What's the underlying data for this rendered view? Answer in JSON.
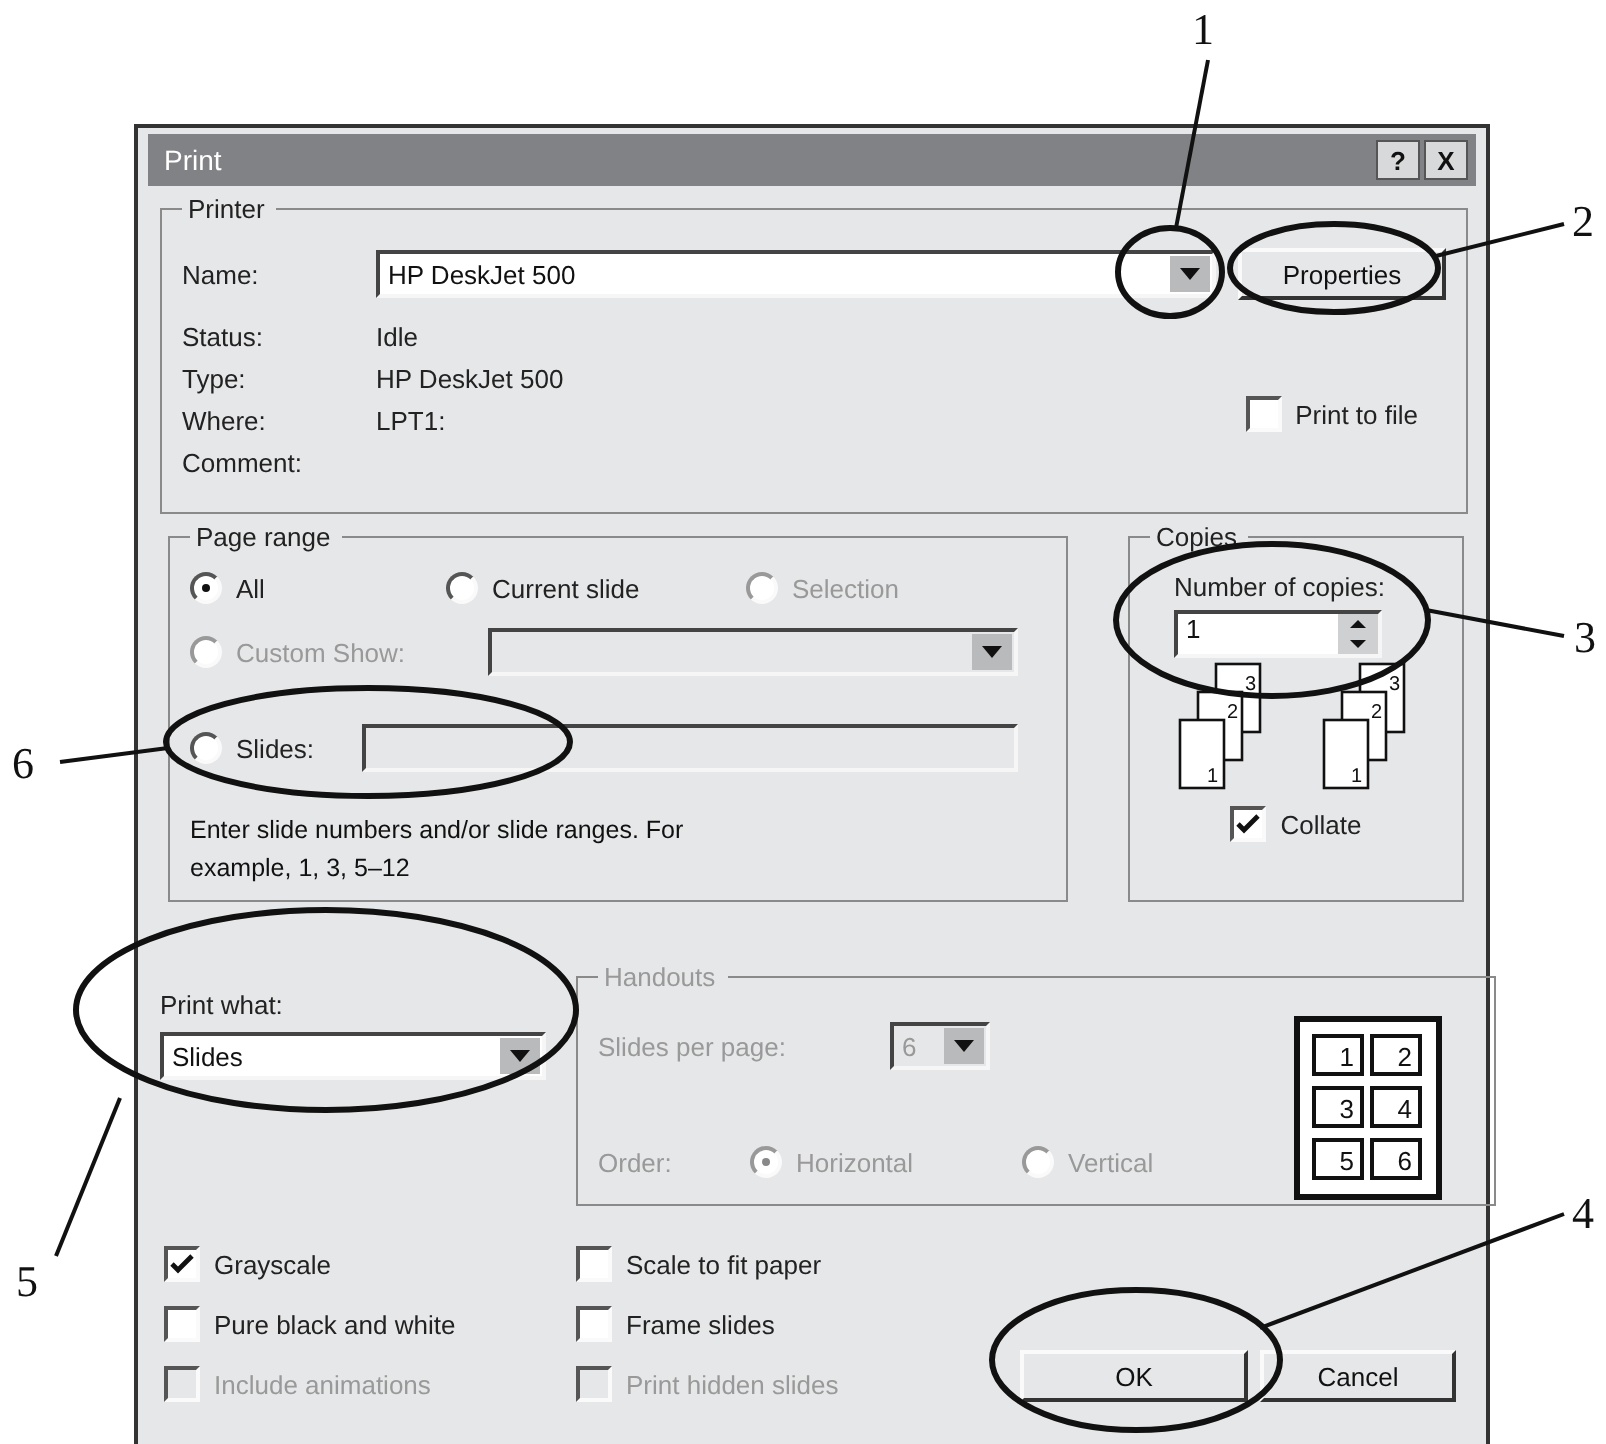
{
  "window": {
    "title": "Print",
    "title_buttons": [
      "?",
      "X"
    ]
  },
  "printer": {
    "legend": "Printer",
    "name_label": "Name:",
    "name_value": "HP DeskJet 500",
    "properties_button": "Properties",
    "details": [
      {
        "label": "Status:",
        "value": "Idle"
      },
      {
        "label": "Type:",
        "value": "HP DeskJet 500"
      },
      {
        "label": "Where:",
        "value": "LPT1:"
      },
      {
        "label": "Comment:"
      }
    ],
    "print_to_file": {
      "label": "Print to file",
      "checked": false
    }
  },
  "page_range": {
    "legend": "Page range",
    "options": [
      {
        "label": "All",
        "selected": true,
        "disabled": false
      },
      {
        "label": "Current slide",
        "selected": false,
        "disabled": false
      },
      {
        "label": "Selection",
        "selected": false,
        "disabled": true
      }
    ],
    "custom_show": {
      "label": "Custom Show:",
      "selected": false,
      "disabled": true
    },
    "slides": {
      "label": "Slides:",
      "selected": false,
      "disabled": false
    },
    "hint": "Enter slide numbers and/or slide ranges. For example, 1, 3, 5–12"
  },
  "copies": {
    "legend": "Copies",
    "label": "Number of copies:",
    "value": "1",
    "stacks": [
      {
        "pages": [
          "1",
          "2",
          "3"
        ]
      },
      {
        "pages": [
          "1",
          "2",
          "3"
        ]
      }
    ],
    "collate": {
      "label": "Collate",
      "checked": true
    }
  },
  "print_what": {
    "label": "Print what:",
    "value": "Slides"
  },
  "handouts": {
    "legend": "Handouts",
    "disabled": true,
    "per_page_label": "Slides per page:",
    "per_page_value": "6",
    "order_label": "Order:",
    "order_options": [
      {
        "label": "Horizontal",
        "selected": true
      },
      {
        "label": "Vertical",
        "selected": false
      }
    ],
    "preview_pages": [
      "1",
      "2",
      "3",
      "4",
      "5",
      "6"
    ]
  },
  "options": [
    {
      "label": "Grayscale",
      "checked": true,
      "disabled": false
    },
    {
      "label": "Scale to fit paper",
      "checked": false,
      "disabled": false
    },
    {
      "label": "Pure black and white",
      "checked": false,
      "disabled": false
    },
    {
      "label": "Frame slides",
      "checked": false,
      "disabled": false
    },
    {
      "label": "Include animations",
      "checked": false,
      "disabled": true
    },
    {
      "label": "Print hidden slides",
      "checked": false,
      "disabled": true
    }
  ],
  "buttons": [
    {
      "label": "OK"
    },
    {
      "label": "Cancel"
    }
  ],
  "callouts": [
    {
      "number": "1"
    },
    {
      "number": "2"
    },
    {
      "number": "3"
    },
    {
      "number": "4"
    },
    {
      "number": "5"
    },
    {
      "number": "6"
    }
  ]
}
